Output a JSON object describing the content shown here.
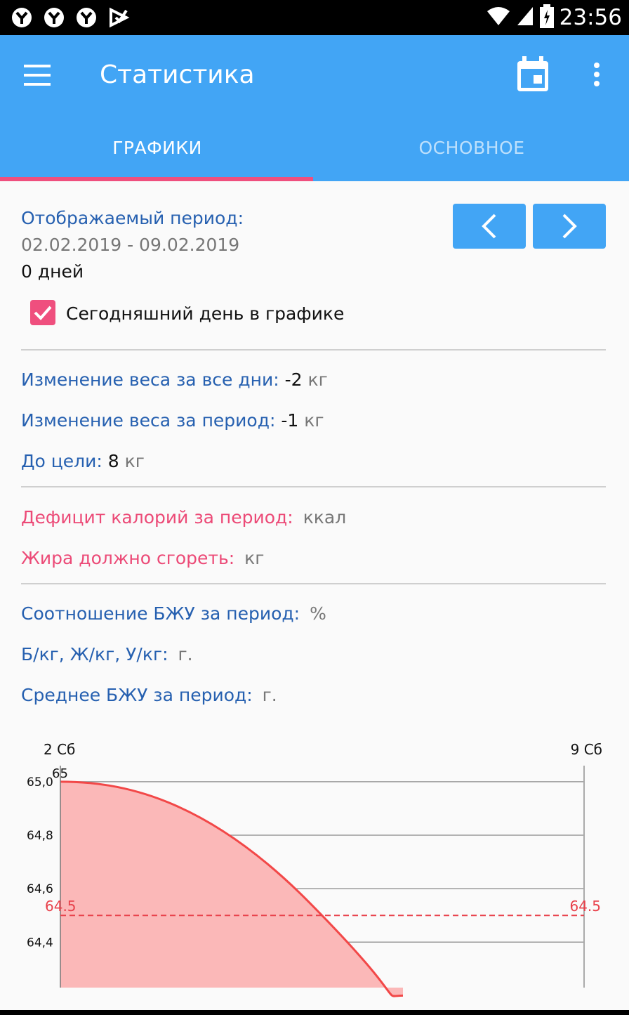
{
  "status_bar": {
    "time": "23:56",
    "icons": [
      "notification-icon",
      "notification-icon",
      "notification-icon",
      "notification-icon",
      "wifi-icon",
      "signal-icon",
      "battery-icon"
    ]
  },
  "app_bar": {
    "title": "Статистика",
    "menu_icon": "hamburger-icon",
    "calendar_icon": "calendar-icon",
    "more_icon": "more-vert-icon",
    "color": "#42a5f5"
  },
  "tabs": [
    {
      "label": "ГРАФИКИ",
      "active": true
    },
    {
      "label": "ОСНОВНОЕ",
      "active": false
    }
  ],
  "period": {
    "label": "Отображаемый период:",
    "range": "02.02.2019 - 09.02.2019",
    "days": "0 дней",
    "prev_icon": "chevron-left-icon",
    "next_icon": "chevron-right-icon"
  },
  "today_checkbox": {
    "label": "Сегодняшний день в графике",
    "checked": true,
    "color": "#ef4f7e"
  },
  "weight": {
    "all_days_label": "Изменение веса за все дни:",
    "all_days_value": "-2",
    "all_days_unit": "кг",
    "period_label": "Изменение веса за период:",
    "period_value": "-1",
    "period_unit": "кг",
    "goal_label": "До цели:",
    "goal_value": "8",
    "goal_unit": "кг"
  },
  "calories": {
    "deficit_label": "Дефицит калорий за период:",
    "deficit_unit": "ккал",
    "fat_label": "Жира должно сгореть:",
    "fat_unit": "кг"
  },
  "macros": {
    "ratio_label": "Соотношение БЖУ за период:",
    "ratio_unit": "%",
    "per_kg_label": "Б/кг, Ж/кг, У/кг:",
    "per_kg_unit": "г.",
    "avg_label": "Среднее БЖУ за период:",
    "avg_unit": "г."
  },
  "chart_data": {
    "type": "area",
    "x": [
      "2 Сб",
      "9 Сб"
    ],
    "series": [
      {
        "values": [
          65.0,
          64.2
        ],
        "color": "#f24848",
        "fill": "#fbb8b8"
      }
    ],
    "point_labels": [
      "65"
    ],
    "target_line": {
      "value": 64.5,
      "label_left": "64.5",
      "label_right": "64.5",
      "color": "#e8404a"
    },
    "y_ticks": [
      "65,0",
      "64,8",
      "64,6",
      "64,4"
    ],
    "y_tick_values": [
      65.0,
      64.8,
      64.6,
      64.4
    ],
    "ylim": [
      64.23,
      65.06
    ],
    "grid": true
  }
}
